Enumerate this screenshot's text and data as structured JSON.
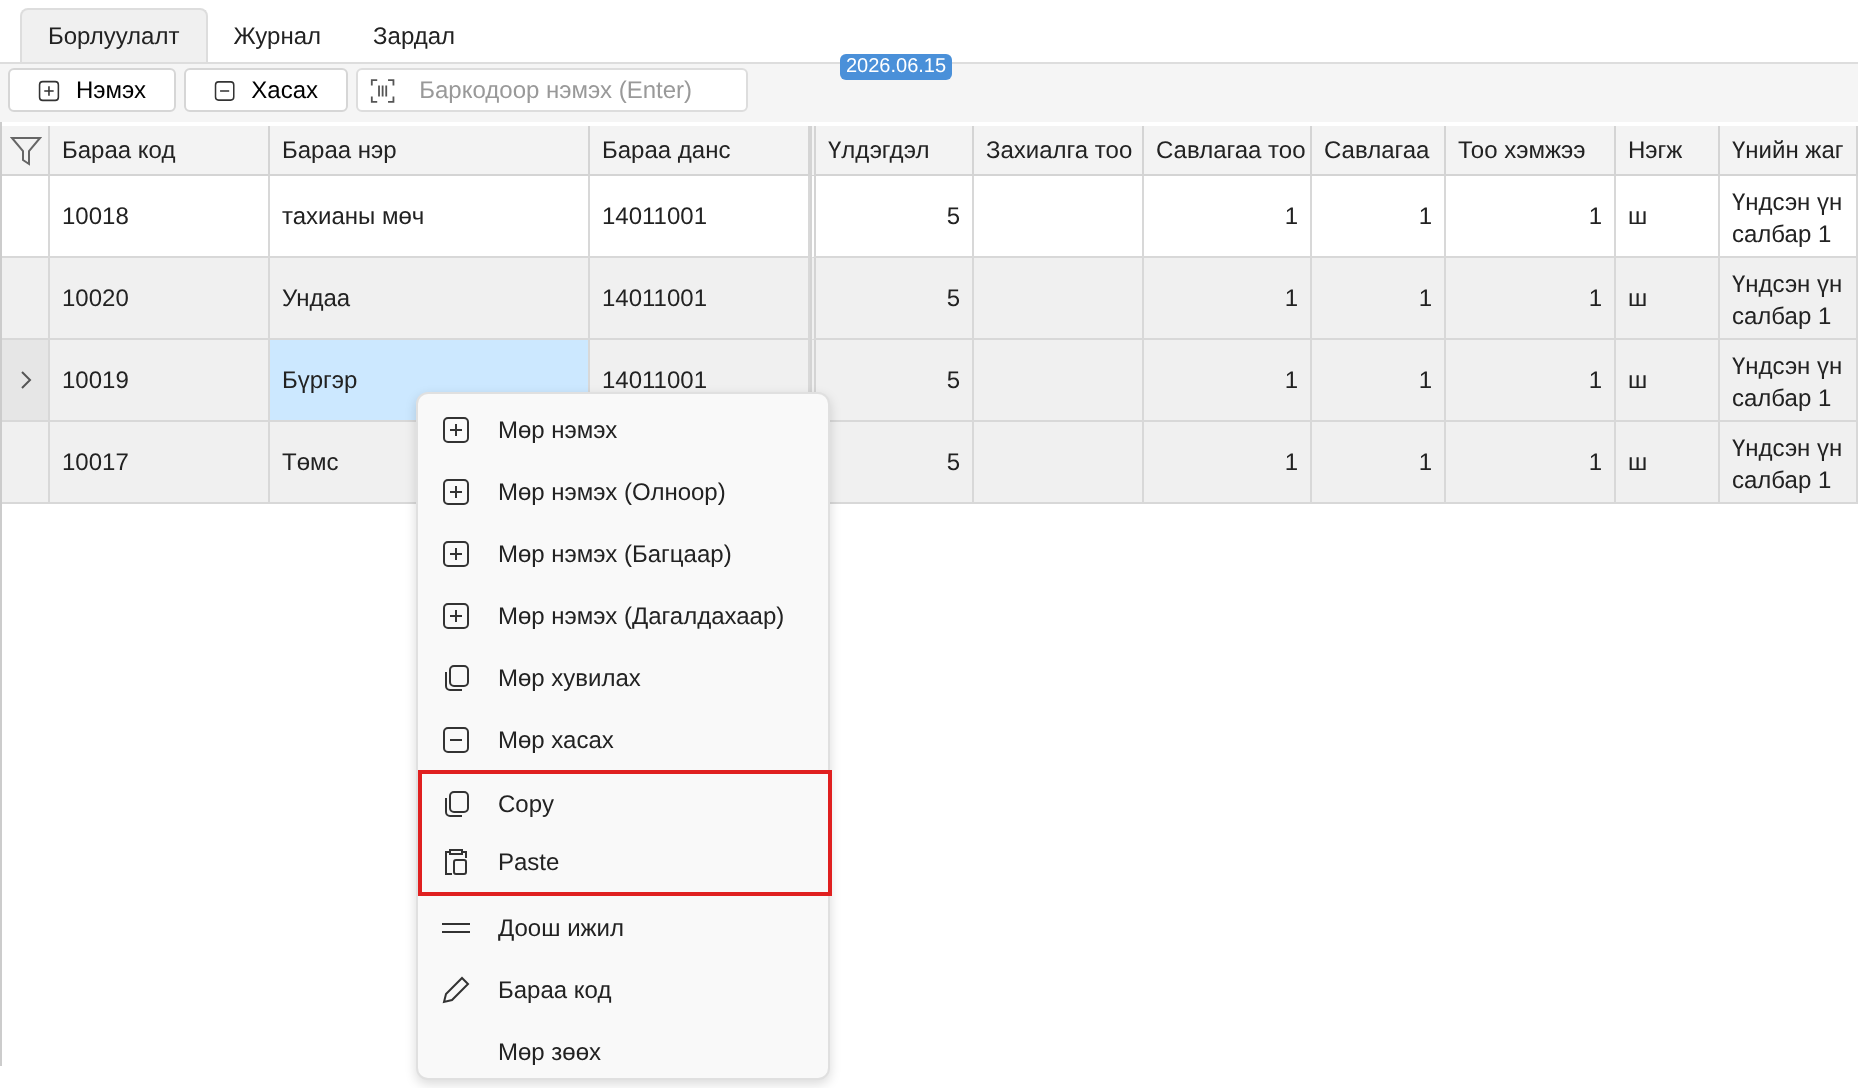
{
  "tabs": [
    {
      "label": "Борлуулалт",
      "selected": true
    },
    {
      "label": "Журнал",
      "selected": false
    },
    {
      "label": "Зардал",
      "selected": false
    }
  ],
  "toolbar": {
    "buttons": [
      {
        "label": "Нэмэх",
        "kind": "plus"
      },
      {
        "label": "Хасах",
        "kind": "minus"
      }
    ],
    "barcode": {
      "placeholder": "Баркодоор нэмэх (Enter)"
    }
  },
  "date_badge": "2026.06.15",
  "table": {
    "columns": [
      "Бараа код",
      "Бараа нэр",
      "Бараа данс",
      "Үлдэгдэл",
      "Захиалга тоо",
      "Савлагаа тоо",
      "Савлагаа",
      "Тоо хэмжээ",
      "Нэгж",
      "Үнийн жаг"
    ],
    "rows": [
      {
        "selected": false,
        "shaded": false,
        "cells": [
          {
            "text": "10018",
            "selected": false
          },
          {
            "text": "тахианы мөч",
            "selected": false
          },
          {
            "text": "14011001",
            "selected": false
          },
          {
            "text": "5",
            "selected": false
          },
          {
            "text": "",
            "selected": false
          },
          {
            "text": "1",
            "selected": false
          },
          {
            "text": "1",
            "selected": false
          },
          {
            "text": "1",
            "selected": false
          },
          {
            "text": "ш",
            "selected": false
          },
          {
            "lines": [
              "Үндсэн үн",
              "салбар 1"
            ],
            "selected": false
          }
        ]
      },
      {
        "selected": false,
        "shaded": true,
        "cells": [
          {
            "text": "10020",
            "selected": false
          },
          {
            "text": "Ундаа",
            "selected": false
          },
          {
            "text": "14011001",
            "selected": false
          },
          {
            "text": "5",
            "selected": false
          },
          {
            "text": "",
            "selected": false
          },
          {
            "text": "1",
            "selected": false
          },
          {
            "text": "1",
            "selected": false
          },
          {
            "text": "1",
            "selected": false
          },
          {
            "text": "ш",
            "selected": false
          },
          {
            "lines": [
              "Үндсэн үн",
              "салбар 1"
            ],
            "selected": false
          }
        ]
      },
      {
        "selected": true,
        "shaded": true,
        "cells": [
          {
            "text": "10019",
            "selected": false
          },
          {
            "text": "Бүргэр",
            "selected": true
          },
          {
            "text": "14011001",
            "selected": false
          },
          {
            "text": "5",
            "selected": false
          },
          {
            "text": "",
            "selected": false
          },
          {
            "text": "1",
            "selected": false
          },
          {
            "text": "1",
            "selected": false
          },
          {
            "text": "1",
            "selected": false
          },
          {
            "text": "ш",
            "selected": false
          },
          {
            "lines": [
              "Үндсэн үн",
              "салбар 1"
            ],
            "selected": false
          }
        ]
      },
      {
        "selected": false,
        "shaded": true,
        "cells": [
          {
            "text": "10017",
            "selected": false
          },
          {
            "text": "Төмс",
            "selected": false
          },
          {},
          {
            "text": "5",
            "selected": false
          },
          {
            "text": "",
            "selected": false
          },
          {
            "text": "1",
            "selected": false
          },
          {
            "text": "1",
            "selected": false
          },
          {
            "text": "1",
            "selected": false
          },
          {
            "text": "ш",
            "selected": false
          },
          {
            "lines": [
              "Үндсэн үн",
              "салбар 1"
            ],
            "selected": false
          }
        ]
      }
    ]
  },
  "context_menu": [
    {
      "label": "Мөр нэмэх",
      "kind": "plus",
      "highlighted": false
    },
    {
      "label": "Мөр нэмэх (Олноор)",
      "kind": "plus",
      "highlighted": false
    },
    {
      "label": "Мөр нэмэх (Багцаар)",
      "kind": "plus",
      "highlighted": false
    },
    {
      "label": "Мөр нэмэх (Дагалдахаар)",
      "kind": "plus",
      "highlighted": false
    },
    {
      "label": "Мөр хувилах",
      "kind": "copy",
      "highlighted": false
    },
    {
      "label": "Мөр хасах",
      "kind": "minus",
      "highlighted": false
    },
    {
      "label": "Copy",
      "kind": "copy",
      "highlighted": true
    },
    {
      "label": "Paste",
      "kind": "paste",
      "highlighted": true
    },
    {
      "label": "Доош ижил",
      "kind": "lines",
      "highlighted": false
    },
    {
      "label": "Бараа код",
      "kind": "pencil",
      "highlighted": false
    },
    {
      "label": "Мөр зөөх",
      "kind": "none",
      "highlighted": false
    }
  ]
}
